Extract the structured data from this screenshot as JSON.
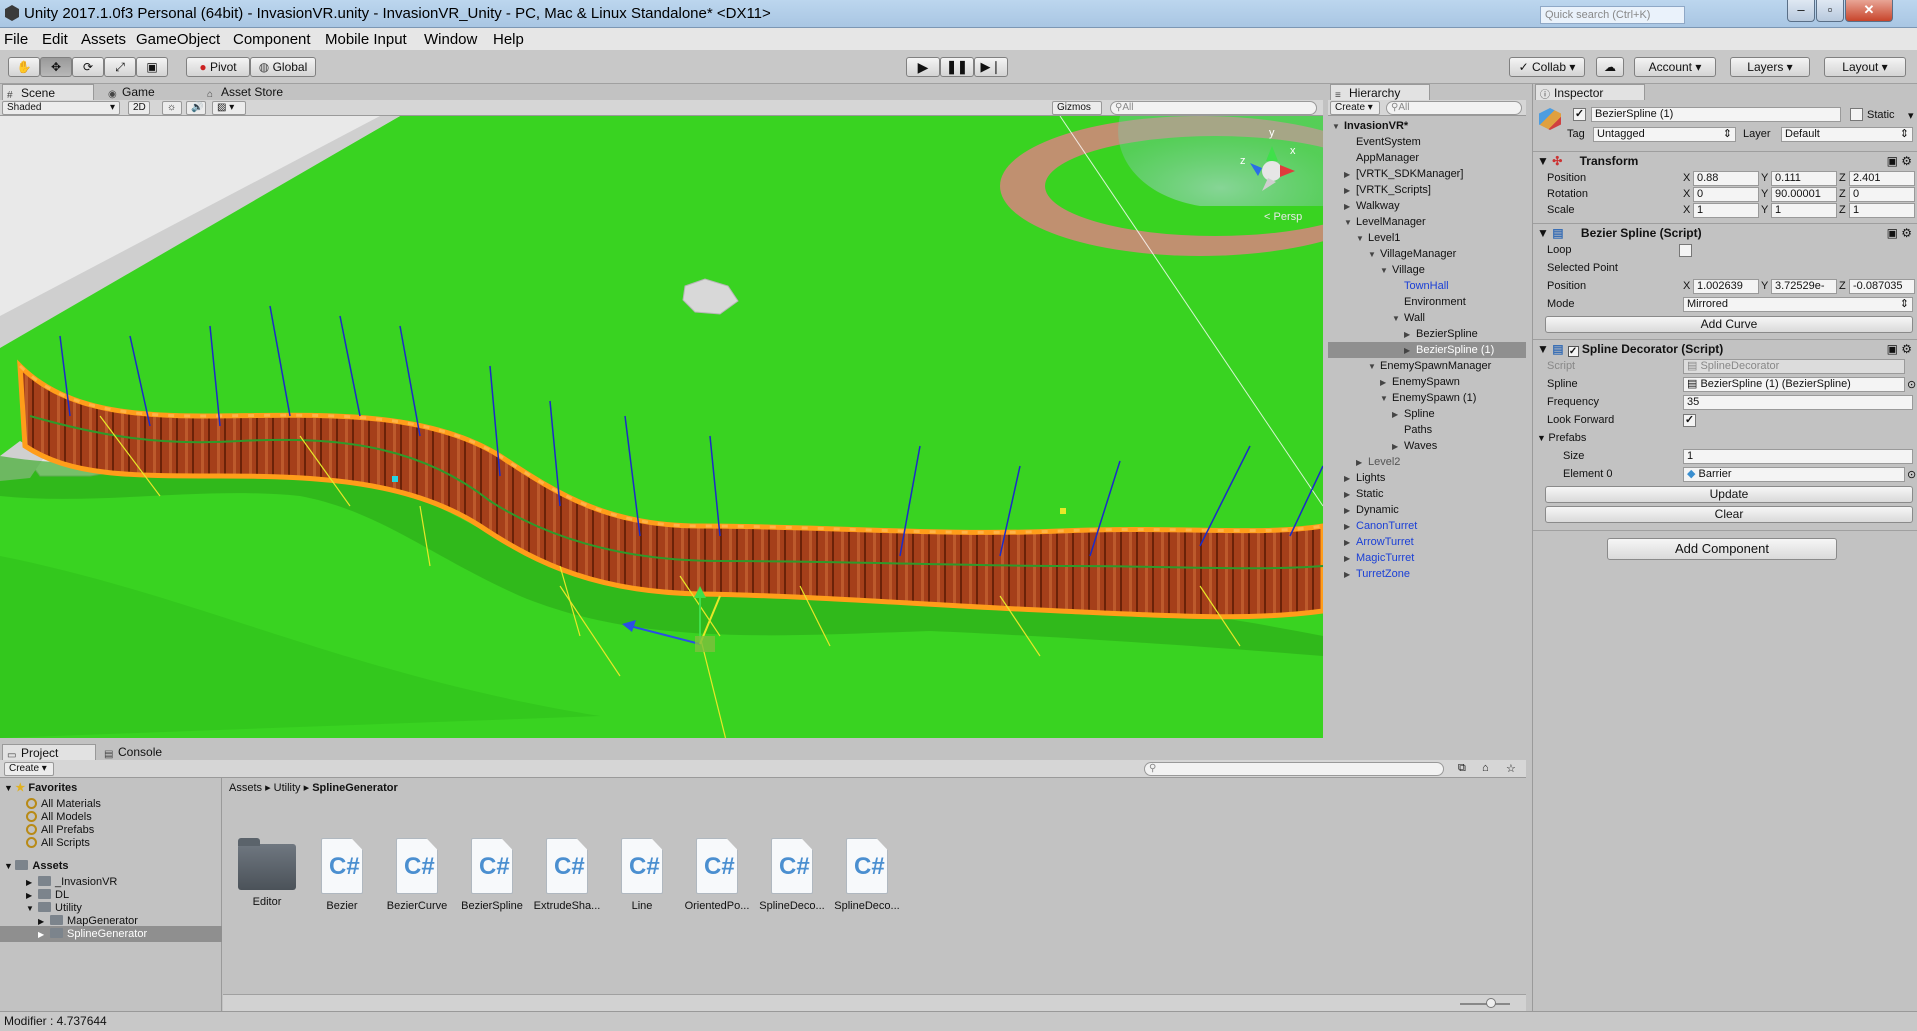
{
  "window": {
    "title": "Unity 2017.1.0f3 Personal (64bit) - InvasionVR.unity - InvasionVR_Unity - PC, Mac & Linux Standalone* <DX11>",
    "quick_search": "Quick search (Ctrl+K)"
  },
  "menu": [
    "File",
    "Edit",
    "Assets",
    "GameObject",
    "Component",
    "Mobile Input",
    "Window",
    "Help"
  ],
  "toolbar": {
    "pivot": "Pivot",
    "global": "Global",
    "collab": "Collab",
    "account": "Account",
    "layers": "Layers",
    "layout": "Layout"
  },
  "scene_view": {
    "tabs": [
      "Scene",
      "Game",
      "Asset Store"
    ],
    "shading": "Shaded",
    "mode_2d": "2D",
    "gizmos": "Gizmos",
    "search_placeholder": "All",
    "persp": "Persp",
    "axes": {
      "x": "x",
      "y": "y",
      "z": "z"
    }
  },
  "hierarchy": {
    "tab": "Hierarchy",
    "create": "Create",
    "search_placeholder": "All",
    "scene": "InvasionVR*",
    "items": [
      {
        "label": "EventSystem",
        "depth": 1,
        "arrow": "",
        "type": "normal"
      },
      {
        "label": "AppManager",
        "depth": 1,
        "arrow": "",
        "type": "normal"
      },
      {
        "label": "[VRTK_SDKManager]",
        "depth": 1,
        "arrow": "▶",
        "type": "normal"
      },
      {
        "label": "[VRTK_Scripts]",
        "depth": 1,
        "arrow": "▶",
        "type": "normal"
      },
      {
        "label": "Walkway",
        "depth": 1,
        "arrow": "▶",
        "type": "normal"
      },
      {
        "label": "LevelManager",
        "depth": 1,
        "arrow": "▼",
        "type": "normal"
      },
      {
        "label": "Level1",
        "depth": 2,
        "arrow": "▼",
        "type": "normal"
      },
      {
        "label": "VillageManager",
        "depth": 3,
        "arrow": "▼",
        "type": "normal"
      },
      {
        "label": "Village",
        "depth": 4,
        "arrow": "▼",
        "type": "normal"
      },
      {
        "label": "TownHall",
        "depth": 5,
        "arrow": "",
        "type": "prefab"
      },
      {
        "label": "Environment",
        "depth": 5,
        "arrow": "",
        "type": "normal"
      },
      {
        "label": "Wall",
        "depth": 5,
        "arrow": "▼",
        "type": "normal"
      },
      {
        "label": "BezierSpline",
        "depth": 6,
        "arrow": "▶",
        "type": "normal"
      },
      {
        "label": "BezierSpline (1)",
        "depth": 6,
        "arrow": "▶",
        "type": "selected"
      },
      {
        "label": "EnemySpawnManager",
        "depth": 3,
        "arrow": "▼",
        "type": "normal"
      },
      {
        "label": "EnemySpawn",
        "depth": 4,
        "arrow": "▶",
        "type": "normal"
      },
      {
        "label": "EnemySpawn (1)",
        "depth": 4,
        "arrow": "▼",
        "type": "normal"
      },
      {
        "label": "Spline",
        "depth": 5,
        "arrow": "▶",
        "type": "normal"
      },
      {
        "label": "Paths",
        "depth": 5,
        "arrow": "",
        "type": "normal"
      },
      {
        "label": "Waves",
        "depth": 5,
        "arrow": "▶",
        "type": "normal"
      },
      {
        "label": "Level2",
        "depth": 2,
        "arrow": "▶",
        "type": "dim"
      },
      {
        "label": "Lights",
        "depth": 1,
        "arrow": "▶",
        "type": "normal"
      },
      {
        "label": "Static",
        "depth": 1,
        "arrow": "▶",
        "type": "normal"
      },
      {
        "label": "Dynamic",
        "depth": 1,
        "arrow": "▶",
        "type": "normal"
      },
      {
        "label": "CanonTurret",
        "depth": 1,
        "arrow": "▶",
        "type": "prefab"
      },
      {
        "label": "ArrowTurret",
        "depth": 1,
        "arrow": "▶",
        "type": "prefab"
      },
      {
        "label": "MagicTurret",
        "depth": 1,
        "arrow": "▶",
        "type": "prefab"
      },
      {
        "label": "TurretZone",
        "depth": 1,
        "arrow": "▶",
        "type": "prefab"
      }
    ]
  },
  "inspector": {
    "tab": "Inspector",
    "object_name": "BezierSpline (1)",
    "static": "Static",
    "tag_label": "Tag",
    "tag": "Untagged",
    "layer_label": "Layer",
    "layer": "Default",
    "transform": {
      "title": "Transform",
      "position_label": "Position",
      "rotation_label": "Rotation",
      "scale_label": "Scale",
      "position": [
        "0.88",
        "0.111",
        "2.401"
      ],
      "rotation": [
        "0",
        "90.00001",
        "0"
      ],
      "scale": [
        "1",
        "1",
        "1"
      ]
    },
    "bezier": {
      "title": "Bezier Spline (Script)",
      "loop_label": "Loop",
      "selected_point_label": "Selected Point",
      "position_label": "Position",
      "position": [
        "1.002639",
        "3.72529e-",
        "-0.087035"
      ],
      "mode_label": "Mode",
      "mode": "Mirrored",
      "add_curve": "Add Curve"
    },
    "decorator": {
      "title": "Spline Decorator (Script)",
      "script_label": "Script",
      "script": "SplineDecorator",
      "spline_label": "Spline",
      "spline": "BezierSpline (1) (BezierSpline)",
      "frequency_label": "Frequency",
      "frequency": "35",
      "look_forward_label": "Look Forward",
      "prefabs_label": "Prefabs",
      "size_label": "Size",
      "size": "1",
      "element0_label": "Element 0",
      "element0": "Barrier",
      "update": "Update",
      "clear": "Clear"
    },
    "add_component": "Add Component",
    "axes": [
      "X",
      "Y",
      "Z"
    ]
  },
  "project": {
    "tabs": [
      "Project",
      "Console"
    ],
    "create": "Create",
    "favorites_label": "Favorites",
    "favorites": [
      "All Materials",
      "All Models",
      "All Prefabs",
      "All Scripts"
    ],
    "assets_label": "Assets",
    "tree": [
      {
        "label": "_InvasionVR",
        "depth": 1,
        "arrow": "▶",
        "sel": false
      },
      {
        "label": "DL",
        "depth": 1,
        "arrow": "▶",
        "sel": false
      },
      {
        "label": "Utility",
        "depth": 1,
        "arrow": "▼",
        "sel": false
      },
      {
        "label": "MapGenerator",
        "depth": 2,
        "arrow": "▶",
        "sel": false
      },
      {
        "label": "SplineGenerator",
        "depth": 2,
        "arrow": "▶",
        "sel": true
      }
    ],
    "breadcrumb": [
      "Assets",
      "Utility",
      "SplineGenerator"
    ],
    "files": [
      {
        "name": "Editor",
        "kind": "folder"
      },
      {
        "name": "Bezier",
        "kind": "script"
      },
      {
        "name": "BezierCurve",
        "kind": "script"
      },
      {
        "name": "BezierSpline",
        "kind": "script"
      },
      {
        "name": "ExtrudeSha...",
        "kind": "script"
      },
      {
        "name": "Line",
        "kind": "script"
      },
      {
        "name": "OrientedPo...",
        "kind": "script"
      },
      {
        "name": "SplineDeco...",
        "kind": "script"
      },
      {
        "name": "SplineDeco...",
        "kind": "script"
      }
    ]
  },
  "status": "Modifier : 4.737644",
  "colors": {
    "grass": "#39d321",
    "wall": "#a8401a",
    "outline": "#ffa21a",
    "titlebar": "#b3cde8",
    "prefab_text": "#1a3fd6"
  }
}
